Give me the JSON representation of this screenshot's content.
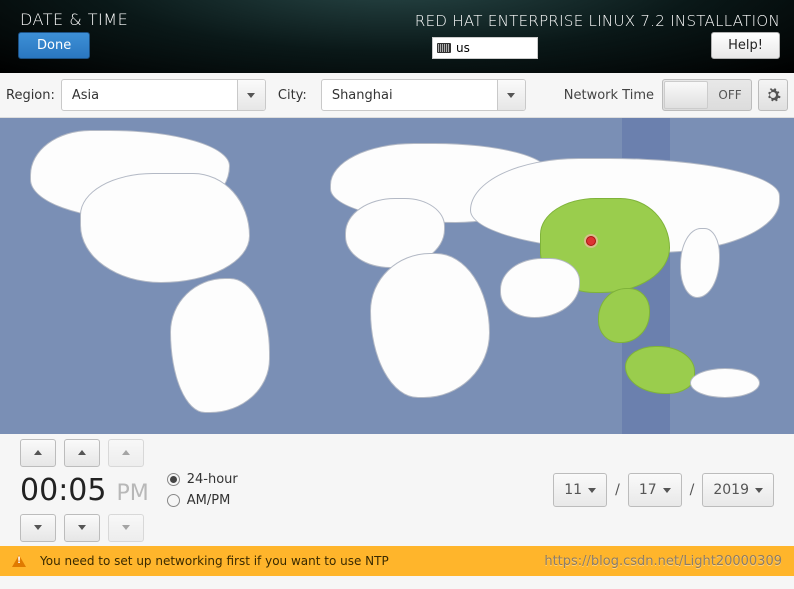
{
  "header": {
    "title_left": "DATE & TIME",
    "title_right": "RED HAT ENTERPRISE LINUX 7.2 INSTALLATION",
    "done_label": "Done",
    "help_label": "Help!",
    "keyboard_layout": "us"
  },
  "toolbar": {
    "region_label": "Region:",
    "region_value": "Asia",
    "city_label": "City:",
    "city_value": "Shanghai",
    "network_time_label": "Network Time",
    "network_time_state": "OFF"
  },
  "time": {
    "hours": "00",
    "minutes": "05",
    "ampm": "PM",
    "mode_24_label": "24-hour",
    "mode_ampm_label": "AM/PM",
    "mode_selected": "24-hour"
  },
  "date": {
    "month": "11",
    "day": "17",
    "year": "2019",
    "sep": "/"
  },
  "warning": {
    "text": "You need to set up networking first if you want to use NTP",
    "watermark": "https://blog.csdn.net/Light20000309"
  }
}
